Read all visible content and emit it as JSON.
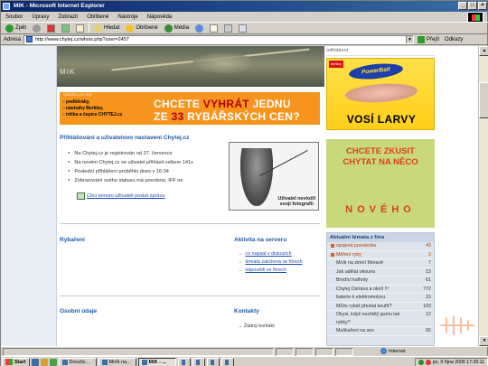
{
  "window": {
    "title": "MIK - Microsoft Internet Explorer",
    "buttons": [
      "_",
      "□",
      "×"
    ]
  },
  "menu": [
    "Soubor",
    "Úpravy",
    "Zobrazit",
    "Oblíbené",
    "Nástroje",
    "Nápověda"
  ],
  "toolbar": {
    "back": "Zpět",
    "search": "Hledat",
    "favorites": "Oblíbené",
    "media": "Média"
  },
  "address": {
    "label": "Adresa",
    "url": "http://www.chytej.cz/whois.php?user=2457",
    "go": "Přejít",
    "links": "Odkazy"
  },
  "header": {
    "logo_text": "MiK"
  },
  "promo": {
    "small": "nabídka pro vás",
    "items": [
      "- podběráky,",
      "- nástrahy Berkley,",
      "- trička a čepice CHYTEJ.cz"
    ],
    "line1": "CHCETE ",
    "line1_red": "VYHRÁT",
    "line1_end": " JEDNU",
    "line2": "ZE ",
    "line2_red": "33",
    "line2_end": " RYBÁŘSKÝCH CEN?"
  },
  "login_section": {
    "title": "Přihlášování a uživatelovo nastavení Chytej.cz",
    "items": [
      "Na Chytej.cz je registrován od 27. července",
      "Na novém Chytej.cz se uživatel přihlásil celkem 141x",
      "Poslední přihlášení proběhlo dnes v 16:34",
      "Zobrazování svého statusu má povoleno, IFF ne"
    ],
    "send_message": "Chci tomuto uživateli poslat zprávu",
    "photo_caption_1": "Uživatel nevložil",
    "photo_caption_2": "svoji fotografii"
  },
  "rybareni": {
    "title": "Rybaření"
  },
  "activity": {
    "title": "Aktivita na serveru",
    "links": [
      "co napsal v diskuzích",
      "témata založená ve fórech",
      "odpovědi ve fórech"
    ]
  },
  "osobni": {
    "title": "Osobní údaje"
  },
  "kontakty": {
    "title": "Kontakty",
    "none": "Žádný kontakt"
  },
  "right": {
    "odhlaseni": "odhlášení",
    "ad1": {
      "brand": "Berkley",
      "logo": "PowerBait",
      "text": "VOSÍ LARVY"
    },
    "ad2": {
      "line1": "CHCETE ZKUSIT",
      "line2": "CHYTAT NA NĚCO",
      "line3": "NOVÉHO"
    },
    "topics_title": "Aktuální témata z fóra",
    "topics": [
      {
        "name": "spojená povolenka",
        "count": "43",
        "dot": true,
        "hl": true
      },
      {
        "name": "Měření ryby",
        "count": "3",
        "dot": true,
        "hl": true
      },
      {
        "name": "Mník na zimní Moravě",
        "count": "7",
        "dot": false,
        "hl": false
      },
      {
        "name": "Jak udělat okouna",
        "count": "13",
        "dot": false,
        "hl": false
      },
      {
        "name": "Brodící kalhoty",
        "count": "61",
        "dot": false,
        "hl": false
      },
      {
        "name": "Chytej Ostrava a okolí !!!",
        "count": "772",
        "dot": false,
        "hl": false
      },
      {
        "name": "baterie k elektromotoru",
        "count": "15",
        "dot": false,
        "hl": false
      },
      {
        "name": "Může rybář přestat kouřit?",
        "count": "103",
        "dot": false,
        "hl": false
      },
      {
        "name": "Okysi, když nechtějí gumu tak rybky?",
        "count": "12",
        "dot": false,
        "hl": false
      },
      {
        "name": "Muškaření na sex",
        "count": "66",
        "dot": false,
        "hl": false
      }
    ]
  },
  "status": {
    "zone": "Internet"
  },
  "taskbar": {
    "start": "Start",
    "tasks": [
      {
        "label": "Doruče...",
        "active": false
      },
      {
        "label": "Mník na...",
        "active": false
      },
      {
        "label": "MiK - ...",
        "active": true
      },
      {
        "label": "",
        "active": false
      },
      {
        "label": "",
        "active": false
      },
      {
        "label": "",
        "active": false
      },
      {
        "label": "",
        "active": false
      }
    ],
    "clock": "po, 9 října 2006 17:39:11"
  },
  "colors": {
    "promo": "#f7941d",
    "link": "#1d4fb0",
    "title_blue": "#1d5aa8",
    "ad1": "#ffd82e",
    "ad2": "#c8d87a",
    "ad_text": "#d9421b"
  }
}
